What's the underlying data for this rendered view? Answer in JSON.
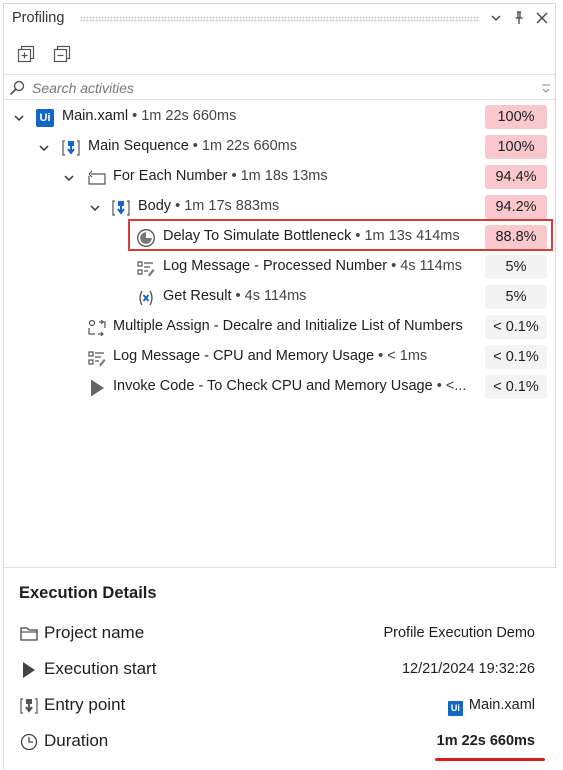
{
  "panel": {
    "title": "Profiling",
    "controls": [
      "chevron-down-icon",
      "pin-icon",
      "close-icon"
    ]
  },
  "toolbar": {
    "expand_all": "expand-all-icon",
    "collapse_all": "collapse-all-icon"
  },
  "search": {
    "placeholder": "Search activities",
    "value": ""
  },
  "tree": [
    {
      "name": "Main.xaml",
      "time": "1m 22s 660ms",
      "percent": "100%",
      "hot": true,
      "icon": "uipath-logo-icon"
    },
    {
      "name": "Main Sequence",
      "time": "1m 22s 660ms",
      "percent": "100%",
      "hot": true,
      "icon": "sequence-icon"
    },
    {
      "name": "For Each Number",
      "time": "1m 18s 13ms",
      "percent": "94.4%",
      "hot": true,
      "icon": "loop-icon"
    },
    {
      "name": "Body",
      "time": "1m 17s 883ms",
      "percent": "94.2%",
      "hot": true,
      "icon": "sequence-icon"
    },
    {
      "name": "Delay To Simulate Bottleneck",
      "time": "1m 13s 414ms",
      "percent": "88.8%",
      "hot": true,
      "icon": "delay-clock-icon",
      "highlighted": true
    },
    {
      "name": "Log Message - Processed Number",
      "time": "4s 114ms",
      "percent": "5%",
      "hot": false,
      "icon": "log-message-icon"
    },
    {
      "name": "Get Result",
      "time": "4s 114ms",
      "percent": "5%",
      "hot": false,
      "icon": "variable-icon"
    },
    {
      "name": "Multiple Assign - Decalre and Initialize List of Numbers",
      "time": "",
      "percent": "< 0.1%",
      "hot": false,
      "icon": "multiple-assign-icon"
    },
    {
      "name": "Log Message - CPU and Memory Usage",
      "time": "< 1ms",
      "percent": "< 0.1%",
      "hot": false,
      "icon": "log-message-icon"
    },
    {
      "name": "Invoke Code - To Check CPU and Memory Usage",
      "time": "<...",
      "percent": "< 0.1%",
      "hot": false,
      "icon": "play-icon"
    }
  ],
  "details": {
    "title": "Execution Details",
    "project_label": "Project name",
    "project_value": "Profile Execution Demo",
    "start_label": "Execution start",
    "start_value": "12/21/2024 19:32:26",
    "entry_label": "Entry point",
    "entry_value": "Main.xaml",
    "entry_logo": "Ui",
    "duration_label": "Duration",
    "duration_value": "1m 22s 660ms"
  },
  "colors": {
    "hot_badge": "#f8c8cc",
    "neutral_badge": "#f3f3f3",
    "highlight_border": "#d93a3a",
    "uipath_blue": "#1466c6",
    "duration_underline": "#d81b1b"
  }
}
